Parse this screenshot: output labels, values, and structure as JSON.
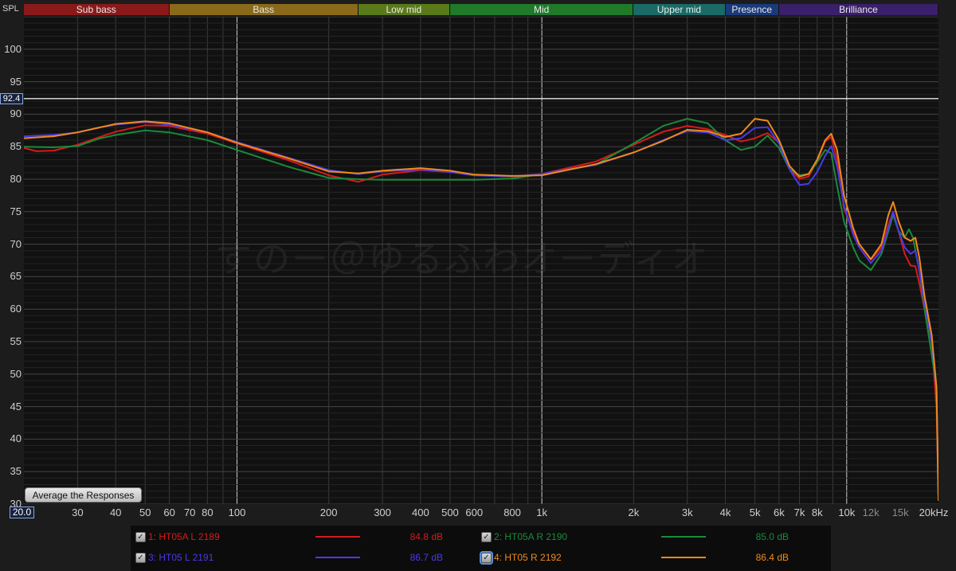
{
  "header": {
    "y_axis_title": "SPL",
    "reference_level_label": "92.4",
    "x_start_label": "20.0"
  },
  "bands": [
    {
      "label": "Sub bass",
      "color": "#8a1a1a"
    },
    {
      "label": "Bass",
      "color": "#8a6a1a"
    },
    {
      "label": "Low mid",
      "color": "#5a7a1a"
    },
    {
      "label": "Mid",
      "color": "#1f7a2a"
    },
    {
      "label": "Upper mid",
      "color": "#1a6a66"
    },
    {
      "label": "Presence",
      "color": "#1a3a7a"
    },
    {
      "label": "Brilliance",
      "color": "#3a1f6a"
    }
  ],
  "watermark": "すのー＠ゆるふわオーディオ",
  "controls": {
    "average_button": "Average the Responses"
  },
  "chart_data": {
    "type": "line",
    "xlabel": "",
    "ylabel": "SPL",
    "x_scale": "log",
    "xlim": [
      20,
      20000
    ],
    "ylim": [
      30,
      105
    ],
    "reference_line": 92.4,
    "grid": true,
    "y_ticks": [
      "100",
      "95",
      "90",
      "85",
      "80",
      "75",
      "70",
      "65",
      "60",
      "55",
      "50",
      "45",
      "40",
      "35",
      "30"
    ],
    "x_ticks": [
      {
        "label": "30",
        "value": 30,
        "minor": false
      },
      {
        "label": "40",
        "value": 40,
        "minor": false
      },
      {
        "label": "50",
        "value": 50,
        "minor": false
      },
      {
        "label": "60",
        "value": 60,
        "minor": false
      },
      {
        "label": "70",
        "value": 70,
        "minor": false
      },
      {
        "label": "80",
        "value": 80,
        "minor": false
      },
      {
        "label": "100",
        "value": 100,
        "minor": false
      },
      {
        "label": "200",
        "value": 200,
        "minor": false
      },
      {
        "label": "300",
        "value": 300,
        "minor": false
      },
      {
        "label": "400",
        "value": 400,
        "minor": false
      },
      {
        "label": "500",
        "value": 500,
        "minor": false
      },
      {
        "label": "600",
        "value": 600,
        "minor": false
      },
      {
        "label": "800",
        "value": 800,
        "minor": false
      },
      {
        "label": "1k",
        "value": 1000,
        "minor": false
      },
      {
        "label": "2k",
        "value": 2000,
        "minor": false
      },
      {
        "label": "3k",
        "value": 3000,
        "minor": false
      },
      {
        "label": "4k",
        "value": 4000,
        "minor": false
      },
      {
        "label": "5k",
        "value": 5000,
        "minor": false
      },
      {
        "label": "6k",
        "value": 6000,
        "minor": false
      },
      {
        "label": "7k",
        "value": 7000,
        "minor": false
      },
      {
        "label": "8k",
        "value": 8000,
        "minor": false
      },
      {
        "label": "10k",
        "value": 10000,
        "minor": false
      },
      {
        "label": "12k",
        "value": 12000,
        "minor": true
      },
      {
        "label": "15k",
        "value": 15000,
        "minor": true
      },
      {
        "label": "20kHz",
        "value": 20000,
        "minor": false
      }
    ],
    "bands_hz": [
      [
        20,
        60
      ],
      [
        60,
        250
      ],
      [
        250,
        500
      ],
      [
        500,
        2000
      ],
      [
        2000,
        4000
      ],
      [
        4000,
        6000
      ],
      [
        6000,
        20000
      ]
    ],
    "series": [
      {
        "name": "1: HT05A L 2189",
        "db": "84.8 dB",
        "color": "#d61a1a",
        "checked": true,
        "selected": false,
        "points": [
          [
            20,
            84.8
          ],
          [
            22,
            84.3
          ],
          [
            25,
            84.4
          ],
          [
            30,
            85.3
          ],
          [
            35,
            86.4
          ],
          [
            40,
            87.3
          ],
          [
            50,
            88.3
          ],
          [
            60,
            88.2
          ],
          [
            80,
            87
          ],
          [
            100,
            85.5
          ],
          [
            150,
            82.8
          ],
          [
            200,
            80.6
          ],
          [
            250,
            79.6
          ],
          [
            300,
            80.7
          ],
          [
            400,
            81.4
          ],
          [
            500,
            81.1
          ],
          [
            600,
            80.6
          ],
          [
            800,
            80.4
          ],
          [
            1000,
            80.8
          ],
          [
            1500,
            82.7
          ],
          [
            2000,
            85.3
          ],
          [
            2500,
            87.3
          ],
          [
            3000,
            88.2
          ],
          [
            3500,
            87.7
          ],
          [
            4000,
            86.8
          ],
          [
            4500,
            85.8
          ],
          [
            5000,
            86.3
          ],
          [
            5500,
            87.1
          ],
          [
            6000,
            85.6
          ],
          [
            6500,
            81.5
          ],
          [
            7000,
            80.1
          ],
          [
            7500,
            80.4
          ],
          [
            8000,
            82.8
          ],
          [
            8500,
            85.8
          ],
          [
            8900,
            86.5
          ],
          [
            9300,
            83
          ],
          [
            9800,
            75.5
          ],
          [
            10500,
            72
          ],
          [
            11000,
            70
          ],
          [
            12000,
            67.6
          ],
          [
            13000,
            69.5
          ],
          [
            13700,
            73
          ],
          [
            14200,
            75
          ],
          [
            14800,
            72
          ],
          [
            15500,
            68.5
          ],
          [
            16200,
            66.7
          ],
          [
            16800,
            66.6
          ],
          [
            17300,
            64
          ],
          [
            18000,
            60
          ],
          [
            19000,
            55
          ],
          [
            19700,
            45
          ],
          [
            20000,
            31
          ]
        ]
      },
      {
        "name": "2: HT05A R 2190",
        "db": "85.0 dB",
        "color": "#1a8a3a",
        "checked": true,
        "selected": false,
        "points": [
          [
            20,
            85
          ],
          [
            25,
            84.9
          ],
          [
            30,
            85.1
          ],
          [
            35,
            86.2
          ],
          [
            40,
            86.8
          ],
          [
            50,
            87.5
          ],
          [
            60,
            87.2
          ],
          [
            80,
            86
          ],
          [
            100,
            84.5
          ],
          [
            150,
            81.8
          ],
          [
            200,
            80.2
          ],
          [
            250,
            80
          ],
          [
            300,
            79.9
          ],
          [
            400,
            79.9
          ],
          [
            500,
            79.9
          ],
          [
            600,
            79.9
          ],
          [
            800,
            80.1
          ],
          [
            1000,
            80.8
          ],
          [
            1500,
            82.2
          ],
          [
            2000,
            85.5
          ],
          [
            2500,
            88.2
          ],
          [
            3000,
            89.3
          ],
          [
            3500,
            88.6
          ],
          [
            4000,
            86
          ],
          [
            4500,
            84.5
          ],
          [
            5000,
            85
          ],
          [
            5500,
            86.7
          ],
          [
            6000,
            84.8
          ],
          [
            6500,
            81.5
          ],
          [
            7000,
            80.6
          ],
          [
            7500,
            80.8
          ],
          [
            8000,
            82.6
          ],
          [
            8500,
            84.5
          ],
          [
            8900,
            84
          ],
          [
            9300,
            79
          ],
          [
            9800,
            73.5
          ],
          [
            10500,
            69.5
          ],
          [
            11000,
            67.5
          ],
          [
            12000,
            66
          ],
          [
            13000,
            68.5
          ],
          [
            13700,
            72
          ],
          [
            14200,
            74.5
          ],
          [
            14800,
            72
          ],
          [
            15500,
            71
          ],
          [
            16000,
            72.3
          ],
          [
            16500,
            71
          ],
          [
            17300,
            66
          ],
          [
            18000,
            60
          ],
          [
            19000,
            53
          ],
          [
            19700,
            48
          ],
          [
            20000,
            31
          ]
        ]
      },
      {
        "name": "3: HT05 L 2191",
        "db": "86.7 dB",
        "color": "#4a3ae8",
        "checked": true,
        "selected": false,
        "points": [
          [
            20,
            86.6
          ],
          [
            25,
            86.8
          ],
          [
            30,
            87.2
          ],
          [
            35,
            87.9
          ],
          [
            40,
            88.4
          ],
          [
            50,
            88.8
          ],
          [
            60,
            88.4
          ],
          [
            80,
            87.2
          ],
          [
            100,
            85.7
          ],
          [
            150,
            83.2
          ],
          [
            200,
            81.4
          ],
          [
            250,
            80.8
          ],
          [
            300,
            81.2
          ],
          [
            400,
            81.5
          ],
          [
            500,
            81.1
          ],
          [
            600,
            80.6
          ],
          [
            800,
            80.4
          ],
          [
            1000,
            80.8
          ],
          [
            1500,
            82.2
          ],
          [
            2000,
            84.1
          ],
          [
            2500,
            86
          ],
          [
            3000,
            87.4
          ],
          [
            3500,
            87.2
          ],
          [
            4000,
            86
          ],
          [
            4500,
            86.3
          ],
          [
            5000,
            87.9
          ],
          [
            5500,
            88
          ],
          [
            6000,
            85.5
          ],
          [
            6500,
            81.5
          ],
          [
            7000,
            79.1
          ],
          [
            7500,
            79.3
          ],
          [
            8000,
            81.1
          ],
          [
            8500,
            83.6
          ],
          [
            8900,
            85.1
          ],
          [
            9300,
            82
          ],
          [
            9800,
            76
          ],
          [
            10500,
            71.5
          ],
          [
            11000,
            69.5
          ],
          [
            12000,
            67.1
          ],
          [
            13000,
            69
          ],
          [
            13700,
            72.5
          ],
          [
            14200,
            75
          ],
          [
            14800,
            72
          ],
          [
            15500,
            69.5
          ],
          [
            16200,
            68.5
          ],
          [
            16800,
            69
          ],
          [
            17300,
            66
          ],
          [
            18000,
            61
          ],
          [
            19000,
            55
          ],
          [
            19700,
            48
          ],
          [
            20000,
            31
          ]
        ]
      },
      {
        "name": "4: HT05 R 2192",
        "db": "86.4 dB",
        "color": "#f08a1a",
        "checked": true,
        "selected": true,
        "points": [
          [
            20,
            86.3
          ],
          [
            25,
            86.6
          ],
          [
            30,
            87.2
          ],
          [
            35,
            87.9
          ],
          [
            40,
            88.5
          ],
          [
            50,
            88.9
          ],
          [
            60,
            88.6
          ],
          [
            80,
            87.2
          ],
          [
            100,
            85.6
          ],
          [
            150,
            83.1
          ],
          [
            200,
            81.2
          ],
          [
            250,
            80.9
          ],
          [
            300,
            81.3
          ],
          [
            400,
            81.7
          ],
          [
            500,
            81.3
          ],
          [
            600,
            80.7
          ],
          [
            800,
            80.5
          ],
          [
            1000,
            80.6
          ],
          [
            1500,
            82.3
          ],
          [
            2000,
            84.1
          ],
          [
            2500,
            85.9
          ],
          [
            3000,
            87.6
          ],
          [
            3500,
            87.4
          ],
          [
            4000,
            86.5
          ],
          [
            4500,
            87
          ],
          [
            5000,
            89.3
          ],
          [
            5500,
            89
          ],
          [
            6000,
            86
          ],
          [
            6500,
            82
          ],
          [
            7000,
            80.4
          ],
          [
            7500,
            80.8
          ],
          [
            8000,
            83
          ],
          [
            8500,
            86
          ],
          [
            8900,
            87
          ],
          [
            9300,
            84.5
          ],
          [
            9800,
            77.5
          ],
          [
            10500,
            72.5
          ],
          [
            11000,
            70
          ],
          [
            12000,
            67.7
          ],
          [
            13000,
            70
          ],
          [
            13700,
            74.5
          ],
          [
            14200,
            76.5
          ],
          [
            14800,
            73.5
          ],
          [
            15500,
            71
          ],
          [
            16200,
            70.5
          ],
          [
            16800,
            71
          ],
          [
            17300,
            68
          ],
          [
            18000,
            62
          ],
          [
            19000,
            56
          ],
          [
            19700,
            48
          ],
          [
            20000,
            30.5
          ]
        ]
      }
    ]
  }
}
